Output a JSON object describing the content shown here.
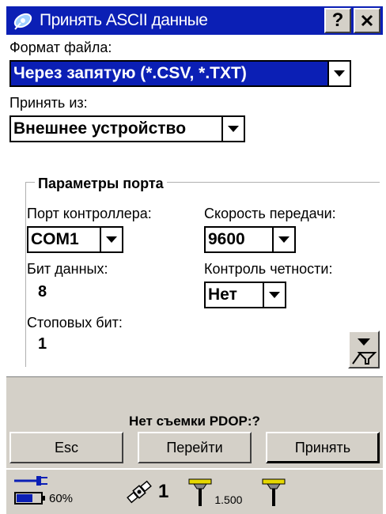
{
  "window": {
    "title": "Принять ASCII данные",
    "help_label": "?",
    "close_label": "✕"
  },
  "file_format": {
    "label": "Формат файла:",
    "value": "Через запятую (*.CSV, *.TXT)"
  },
  "import_from": {
    "label": "Принять из:",
    "value": "Внешнее устройство"
  },
  "port_params": {
    "title": "Параметры порта",
    "controller_port": {
      "label": "Порт контроллера:",
      "value": "COM1"
    },
    "baud_rate": {
      "label": "Скорость передачи:",
      "value": "9600"
    },
    "data_bits": {
      "label": "Бит данных:",
      "value": "8"
    },
    "parity": {
      "label": "Контроль четности:",
      "value": "Нет"
    },
    "stop_bits": {
      "label": "Стоповых бит:",
      "value": "1"
    }
  },
  "status": {
    "text": "Нет съемки  PDOP:?"
  },
  "buttons": {
    "esc": "Esc",
    "goto": "Перейти",
    "accept": "Принять"
  },
  "taskbar": {
    "battery": "60%",
    "satellites": "1",
    "antenna_height": "1.500"
  },
  "colors": {
    "titlebar": "#0b1fb5",
    "selection": "#0b1fb5",
    "chrome": "#d4d0c8"
  }
}
